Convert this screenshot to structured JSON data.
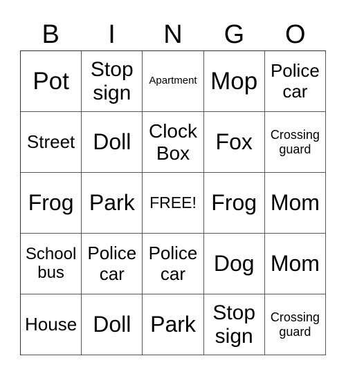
{
  "card": {
    "header": [
      "B",
      "I",
      "N",
      "G",
      "O"
    ],
    "cells": [
      [
        "Pot",
        "Stop sign",
        "Apartment",
        "Mop",
        "Police car"
      ],
      [
        "Street",
        "Doll",
        "Clock Box",
        "Fox",
        "Crossing guard"
      ],
      [
        "Frog",
        "Park",
        "FREE!",
        "Frog",
        "Mom"
      ],
      [
        "School bus",
        "Police car",
        "Police car",
        "Dog",
        "Mom"
      ],
      [
        "House",
        "Doll",
        "Park",
        "Stop sign",
        "Crossing guard"
      ]
    ]
  }
}
